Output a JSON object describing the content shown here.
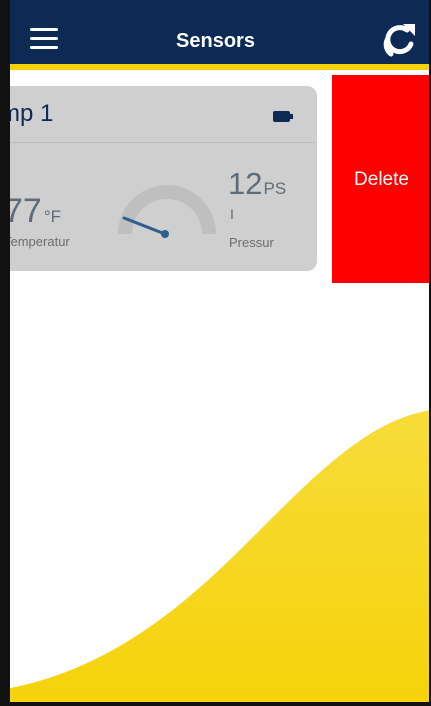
{
  "header": {
    "title": "Sensors",
    "menu_icon": "hamburger-menu-icon",
    "refresh_icon": "refresh-icon",
    "bg_color": "#0d2a55",
    "accent_color": "#f5d20a"
  },
  "sensor_card": {
    "name": "mp 1",
    "battery_icon": "battery-icon",
    "temperature": {
      "value": "77",
      "unit": "°F",
      "label": "Temperatur"
    },
    "pressure": {
      "value": "12",
      "unit": "PS",
      "unit_cont": "I",
      "label": "Pressur"
    },
    "gauge_icon": "pressure-gauge-icon"
  },
  "swipe_action": {
    "label": "Delete",
    "color": "#ff0000"
  },
  "background": {
    "wave_color": "#f7d615"
  }
}
